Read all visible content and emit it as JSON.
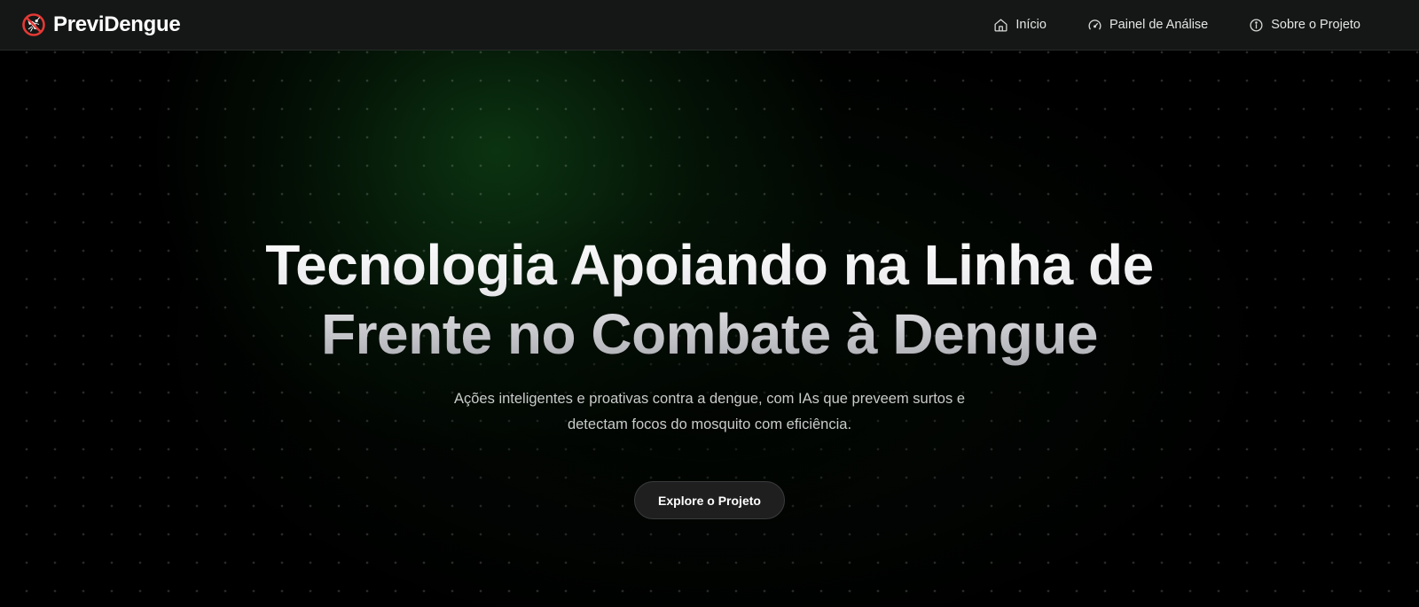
{
  "brand": {
    "name": "PreviDengue",
    "logo_icon": "mosquito-prohibited-icon",
    "logo_color": "#e53935"
  },
  "nav": {
    "items": [
      {
        "label": "Início",
        "icon": "home-icon"
      },
      {
        "label": "Painel de Análise",
        "icon": "gauge-icon"
      },
      {
        "label": "Sobre o Projeto",
        "icon": "info-icon"
      }
    ]
  },
  "hero": {
    "title_line1": "Tecnologia Apoiando na Linha de",
    "title_line2": "Frente no Combate à Dengue",
    "subtitle_line1": "Ações inteligentes e proativas contra a dengue, com IAs que preveem surtos e",
    "subtitle_line2": "detectam focos do mosquito com eficiência.",
    "cta_label": "Explore o Projeto"
  },
  "colors": {
    "background": "#000000",
    "navbar": "#151716",
    "glow": "#145a1e",
    "button": "#1f1f20"
  }
}
